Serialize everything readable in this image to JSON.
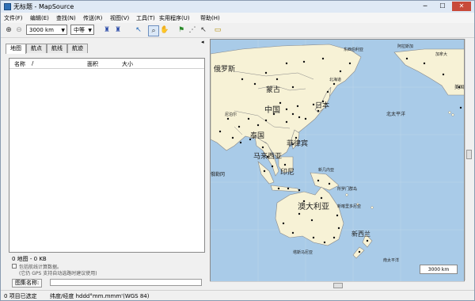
{
  "window": {
    "title": "无标题 - MapSource",
    "min": "─",
    "max": "☐",
    "close": "✕"
  },
  "menu": [
    "文件(F)",
    "编辑(E)",
    "查找(N)",
    "传送(R)",
    "视图(V)",
    "工具(T)",
    "实用程序(U)",
    "帮助(H)"
  ],
  "toolbar": {
    "zoom_value": "3000 km",
    "detail_value": "中等"
  },
  "left_panel": {
    "tabs": [
      "地图",
      "航点",
      "航线",
      "航迹"
    ],
    "columns": [
      "名称",
      "/",
      "面积",
      "大小"
    ],
    "summary": "0 地图 - 0 KB",
    "checkbox_label": "包括航线计算数据。",
    "hint": "(它仍 GPS 支持自动选路时建议使用)",
    "mapset_label": "图集名称:"
  },
  "map": {
    "scale": "3000 km",
    "labels": [
      "东西伯利亚",
      "俄罗斯",
      "蒙古",
      "中国",
      "日本",
      "北太平洋",
      "菲律宾",
      "泰国",
      "马来西亚",
      "印尼",
      "澳大利亚",
      "新西兰",
      "南太平洋",
      "加拿大",
      "美国",
      "新几内亚",
      "尼泊尔",
      "北海道",
      "俄勒冈",
      "新喀里多尼亚",
      "所罗门群岛",
      "塔斯马尼亚",
      "阿拉斯加"
    ],
    "colors": {
      "water": "#a9cbe8",
      "land": "#f7f2d6",
      "border": "#888888"
    }
  },
  "status": {
    "selection": "0 项目已选定",
    "coords": "纬度/经度 hddd°mm.mmm'(WGS 84)"
  }
}
